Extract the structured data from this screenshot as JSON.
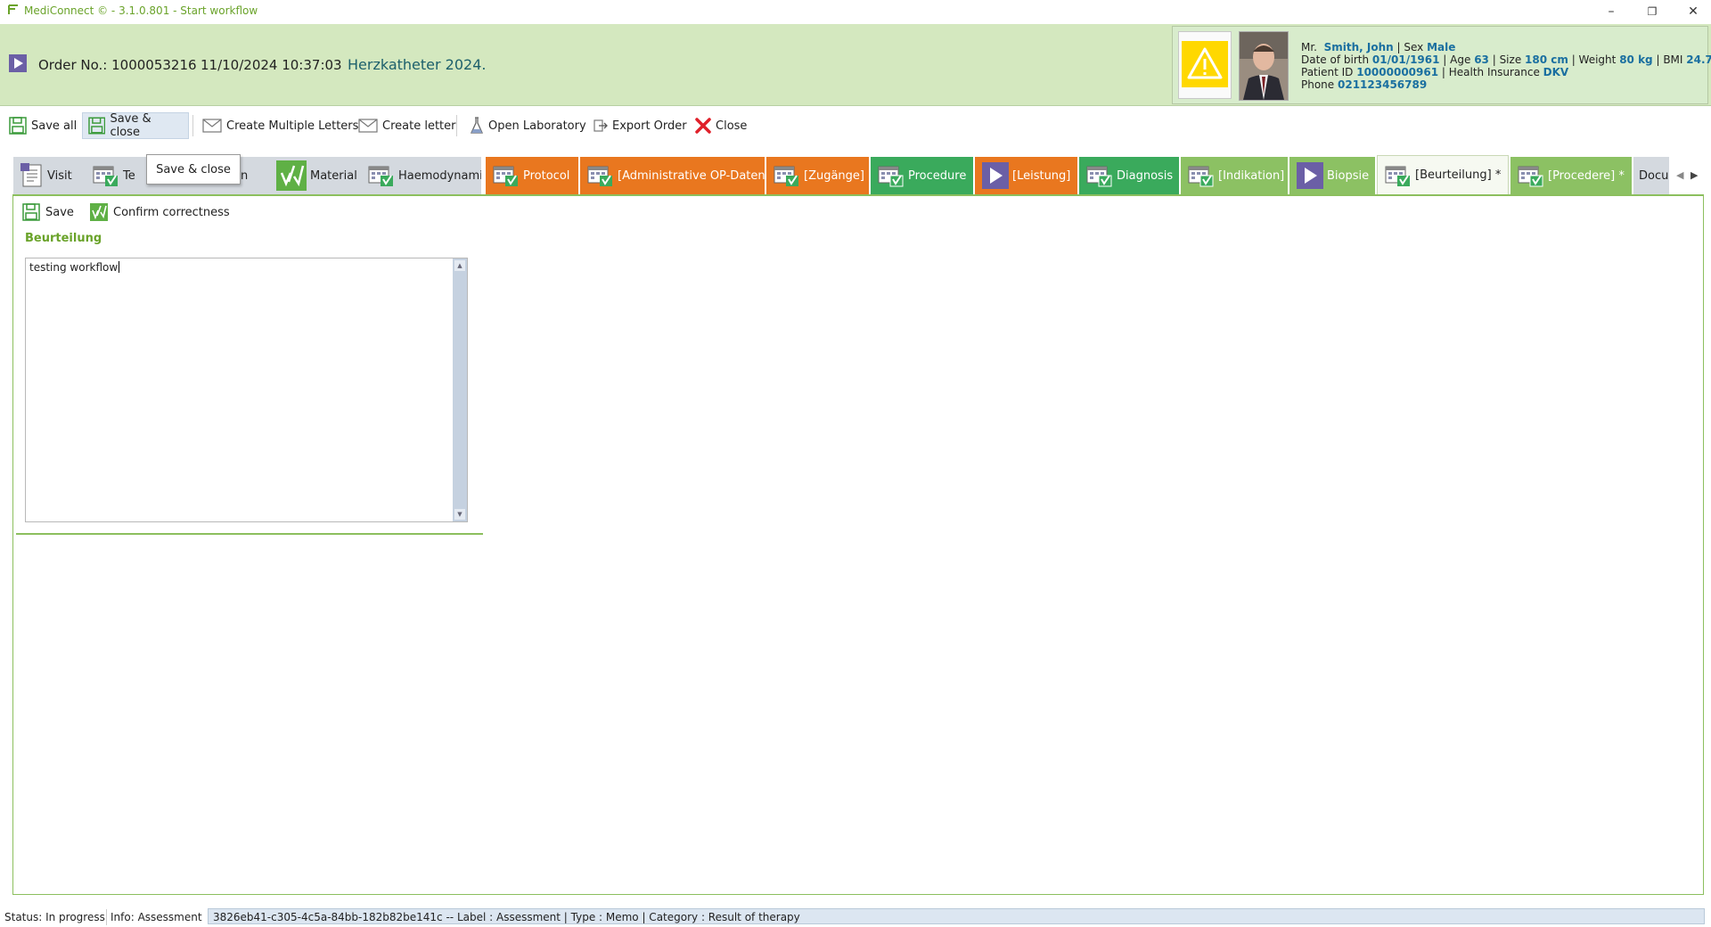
{
  "window": {
    "title": "MediConnect © - 3.1.0.801 - Start workflow",
    "minimize": "–",
    "restore": "❐",
    "close": "✕"
  },
  "header": {
    "order_label": "Order No.: 1000053216",
    "order_date": "11/10/2024 10:37:03",
    "order_title": "Herzkatheter 2024.",
    "patient": {
      "salutation": "Mr.",
      "name": "Smith, John",
      "sex_label": "Sex",
      "sex": "Male",
      "dob_label": "Date of birth",
      "dob": "01/01/1961",
      "age_label": "Age",
      "age": "63",
      "size_label": "Size",
      "size": "180 cm",
      "weight_label": "Weight",
      "weight": "80 kg",
      "bmi_label": "BMI",
      "bmi": "24.7",
      "patient_id_label": "Patient ID",
      "patient_id": "10000000961",
      "insurance_label": "Health Insurance",
      "insurance": "DKV",
      "phone_label": "Phone",
      "phone": "021123456789"
    }
  },
  "toolbar": {
    "save_all": "Save all",
    "save_close": "Save & close",
    "create_multiple_letters": "Create Multiple Letters",
    "create_letter": "Create letter",
    "open_laboratory": "Open Laboratory",
    "export_order": "Export Order",
    "close": "Close"
  },
  "tooltip": {
    "text": "Save & close"
  },
  "tabs": [
    {
      "label": "Visit"
    },
    {
      "label": "Te"
    },
    {
      "label": "n"
    },
    {
      "label": "Material"
    },
    {
      "label": "Haemodynamics"
    },
    {
      "label": "Protocol"
    },
    {
      "label": "[Administrative OP-Daten]"
    },
    {
      "label": "[Zugänge]"
    },
    {
      "label": "Procedure"
    },
    {
      "label": "[Leistung]"
    },
    {
      "label": "Diagnosis"
    },
    {
      "label": "[Indikation]"
    },
    {
      "label": "Biopsie"
    },
    {
      "label": "[Beurteilung] *"
    },
    {
      "label": "[Procedere] *"
    },
    {
      "label": "Docu"
    }
  ],
  "content": {
    "save": "Save",
    "confirm": "Confirm correctness",
    "section_title": "Beurteilung",
    "memo_text": "testing workflow"
  },
  "status": {
    "status": "Status: In progress",
    "info": "Info: Assessment",
    "details": "3826eb41-c305-4c5a-84bb-182b82be141c  -- Label : Assessment | Type : Memo | Category : Result of therapy"
  },
  "colors": {
    "header_bg": "#d4e8bf",
    "tab_orange": "#e9771f",
    "tab_green": "#3aaa5c",
    "tab_olive": "#8cc163",
    "accent_green": "#6aa32a"
  }
}
